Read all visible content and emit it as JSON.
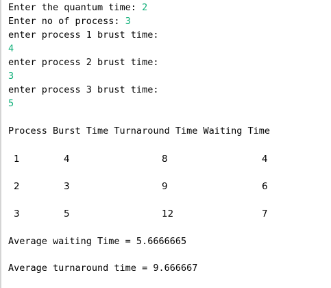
{
  "console": {
    "quantum_prompt": "Enter the quantum time: ",
    "quantum_value": "2",
    "count_prompt": "Enter no of process: ",
    "count_value": "3",
    "p1_prompt": "enter process 1 brust time:",
    "p1_value": "4",
    "p2_prompt": "enter process 2 brust time:",
    "p2_value": "3",
    "p3_prompt": "enter process 3 brust time:",
    "p3_value": "5",
    "table_header": "Process Burst Time Turnaround Time Waiting Time",
    "rows": [
      {
        "process": "1",
        "burst": "4",
        "turnaround": "8",
        "waiting": "4"
      },
      {
        "process": "2",
        "burst": "3",
        "turnaround": "9",
        "waiting": "6"
      },
      {
        "process": "3",
        "burst": "5",
        "turnaround": "12",
        "waiting": "7"
      }
    ],
    "avg_waiting": "Average waiting Time = 5.6666665",
    "avg_turnaround": "Average turnaround time = 9.666667"
  },
  "colors": {
    "input_text": "#12b07a",
    "output_text": "#000000",
    "background": "#ffffff"
  }
}
